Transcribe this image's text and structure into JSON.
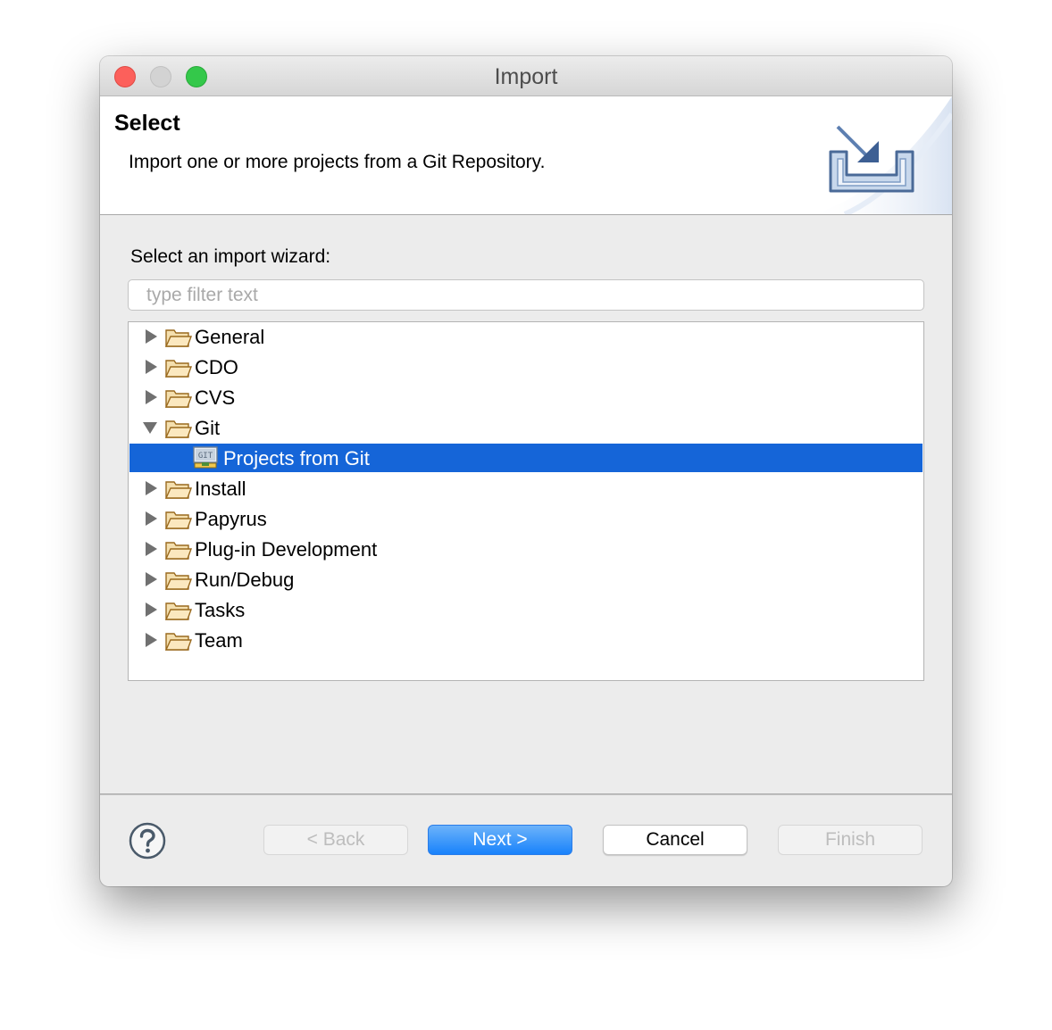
{
  "window": {
    "title": "Import"
  },
  "banner": {
    "title": "Select",
    "description": "Import one or more projects from a Git Repository.",
    "icon": "import-icon"
  },
  "wizard": {
    "label": "Select an import wizard:",
    "filter_placeholder": "type filter text",
    "filter_value": ""
  },
  "tree": {
    "items": [
      {
        "label": "General",
        "expanded": false,
        "icon": "folder-icon"
      },
      {
        "label": "CDO",
        "expanded": false,
        "icon": "folder-icon"
      },
      {
        "label": "CVS",
        "expanded": false,
        "icon": "folder-icon"
      },
      {
        "label": "Git",
        "expanded": true,
        "icon": "folder-icon"
      },
      {
        "label": "Projects from Git",
        "child_of": "Git",
        "selected": true,
        "icon": "git-projects-icon"
      },
      {
        "label": "Install",
        "expanded": false,
        "icon": "folder-icon"
      },
      {
        "label": "Papyrus",
        "expanded": false,
        "icon": "folder-icon"
      },
      {
        "label": "Plug-in Development",
        "expanded": false,
        "icon": "folder-icon"
      },
      {
        "label": "Run/Debug",
        "expanded": false,
        "icon": "folder-icon"
      },
      {
        "label": "Tasks",
        "expanded": false,
        "icon": "folder-icon"
      },
      {
        "label": "Team",
        "expanded": false,
        "icon": "folder-icon"
      }
    ]
  },
  "buttons": {
    "back": "< Back",
    "next": "Next >",
    "cancel": "Cancel",
    "finish": "Finish"
  },
  "colors": {
    "selection": "#1565d8",
    "primary_button": "#1882fb",
    "close_light": "#fc605b",
    "maximize_light": "#34c84a"
  }
}
